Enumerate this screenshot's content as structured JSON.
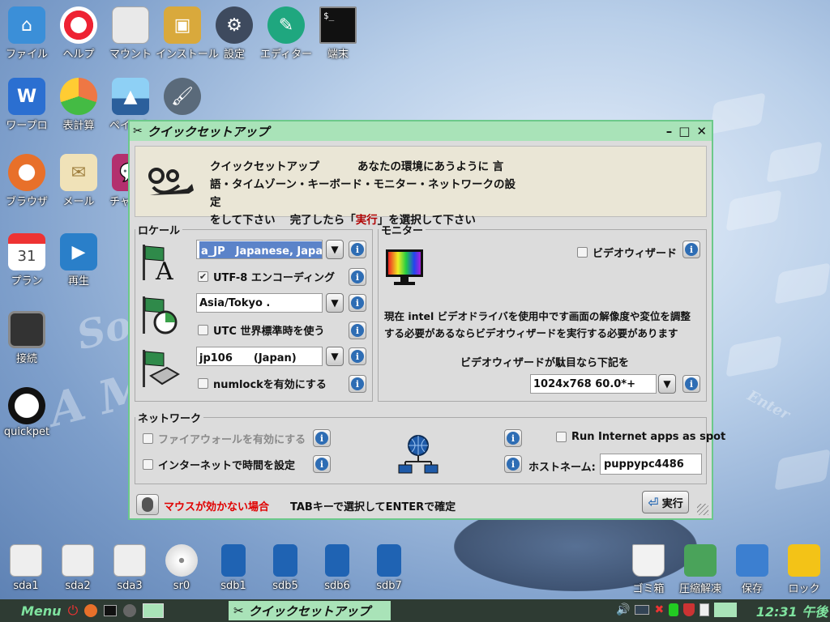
{
  "desktop": {
    "icons_top": [
      {
        "label": "ファイル"
      },
      {
        "label": "ヘルプ"
      },
      {
        "label": "マウント"
      },
      {
        "label": "インストール"
      },
      {
        "label": "設定"
      },
      {
        "label": "エディター"
      },
      {
        "label": "端末"
      }
    ],
    "icons_left": [
      {
        "label": "ワープロ"
      },
      {
        "label": "表計算"
      },
      {
        "label": "ペイント"
      },
      {
        "label": "ブラウザ"
      },
      {
        "label": "メール"
      },
      {
        "label": "チャット"
      },
      {
        "label": "プラン"
      },
      {
        "label": "再生"
      },
      {
        "label": "接続"
      },
      {
        "label": "quickpet"
      }
    ],
    "calendar_day": "31",
    "drives": [
      "sda1",
      "sda2",
      "sda3",
      "sr0",
      "sdb1",
      "sdb5",
      "sdb6",
      "sdb7"
    ],
    "right_icons": [
      "ゴミ箱",
      "圧縮解凍",
      "保存",
      "ロック"
    ],
    "background_words": [
      "So",
      "A M",
      "Enter"
    ]
  },
  "window": {
    "title": "クイックセットアップ",
    "header": {
      "line1_a": "クイックセットアップ",
      "line1_b": "あなたの環境にあうように 言",
      "line2": "語・タイムゾーン・キーボード・モニター・ネットワークの設定",
      "line3_a": "をして下さい　 完了したら「",
      "line3_b": "実行",
      "line3_c": "」を選択して下さい"
    },
    "locale": {
      "legend": "ロケール",
      "language_value": "a_JP　Japanese, Japan",
      "utf8_label": "UTF-8 エンコーディング",
      "utf8_checked": true,
      "timezone_value": "Asia/Tokyo .",
      "utc_label": "UTC 世界標準時を使う",
      "utc_checked": false,
      "keyboard_value": "jp106　　(Japan)",
      "numlock_label": "numlockを有効にする",
      "numlock_checked": false
    },
    "monitor": {
      "legend": "モニター",
      "wizard_label": "ビデオウィザード",
      "wizard_checked": false,
      "desc_line1": "現在  intel ビデオドライバを使用中です画面の解像度や変位を調整",
      "desc_line2": "する必要があるならビデオウィザードを実行する必要があります",
      "fallback_label": "ビデオウィザードが駄目なら下記を",
      "resolution_value": "1024x768  60.0*+"
    },
    "network": {
      "legend": "ネットワーク",
      "firewall_label": "ファイアウォールを有効にする",
      "time_label": "インターネットで時間を設定",
      "spot_label": "Run Internet apps as spot",
      "hostname_label": "ホストネーム:",
      "hostname_value": "puppypc4486"
    },
    "footer": {
      "mouse_help": "マウスが効かない場合",
      "tab_help": "TABキーで選択してENTERで確定",
      "run_button": "実行"
    }
  },
  "taskbar": {
    "menu_label": "Menu",
    "task_label": "クイックセットアップ",
    "clock": "12:31 午後"
  },
  "colors": {
    "accent_green": "#a9e3b8",
    "taskbar": "#2e3b33",
    "warning_red": "#e00000",
    "info_blue": "#2e6db4"
  }
}
